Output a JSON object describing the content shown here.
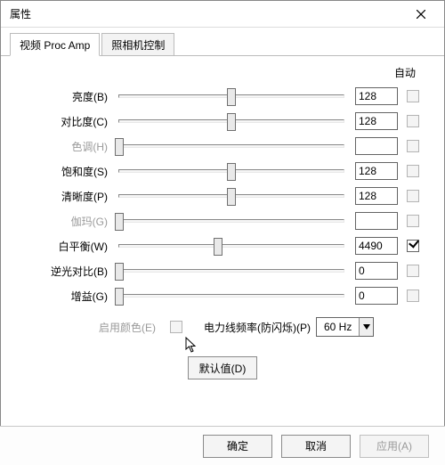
{
  "window": {
    "title": "属性"
  },
  "tabs": [
    {
      "label": "视频 Proc Amp",
      "active": true
    },
    {
      "label": "照相机控制",
      "active": false
    }
  ],
  "headers": {
    "auto": "自动"
  },
  "rows": [
    {
      "key": "brightness",
      "label": "亮度(B)",
      "value": "128",
      "pos": 50,
      "disabled": false,
      "auto": false,
      "auto_disabled": true,
      "show_value": true
    },
    {
      "key": "contrast",
      "label": "对比度(C)",
      "value": "128",
      "pos": 50,
      "disabled": false,
      "auto": false,
      "auto_disabled": true,
      "show_value": true
    },
    {
      "key": "hue",
      "label": "色调(H)",
      "value": "",
      "pos": 0,
      "disabled": true,
      "auto": false,
      "auto_disabled": true,
      "show_value": false
    },
    {
      "key": "saturation",
      "label": "饱和度(S)",
      "value": "128",
      "pos": 50,
      "disabled": false,
      "auto": false,
      "auto_disabled": true,
      "show_value": true
    },
    {
      "key": "sharpness",
      "label": "清晰度(P)",
      "value": "128",
      "pos": 50,
      "disabled": false,
      "auto": false,
      "auto_disabled": true,
      "show_value": true
    },
    {
      "key": "gamma",
      "label": "伽玛(G)",
      "value": "",
      "pos": 0,
      "disabled": true,
      "auto": false,
      "auto_disabled": true,
      "show_value": false
    },
    {
      "key": "whitebal",
      "label": "白平衡(W)",
      "value": "4490",
      "pos": 44,
      "disabled": false,
      "auto": true,
      "auto_disabled": false,
      "show_value": true
    },
    {
      "key": "backlight",
      "label": "逆光对比(B)",
      "value": "0",
      "pos": 0,
      "disabled": false,
      "auto": false,
      "auto_disabled": true,
      "show_value": true
    },
    {
      "key": "gain",
      "label": "增益(G)",
      "value": "0",
      "pos": 0,
      "disabled": false,
      "auto": false,
      "auto_disabled": true,
      "show_value": true
    }
  ],
  "color_enable": {
    "label": "启用颜色(E)",
    "checked": false,
    "disabled": true
  },
  "powerline": {
    "label": "电力线频率(防闪烁)(P)",
    "value": "60 Hz"
  },
  "buttons": {
    "defaults": "默认值(D)",
    "ok": "确定",
    "cancel": "取消",
    "apply": "应用(A)"
  }
}
